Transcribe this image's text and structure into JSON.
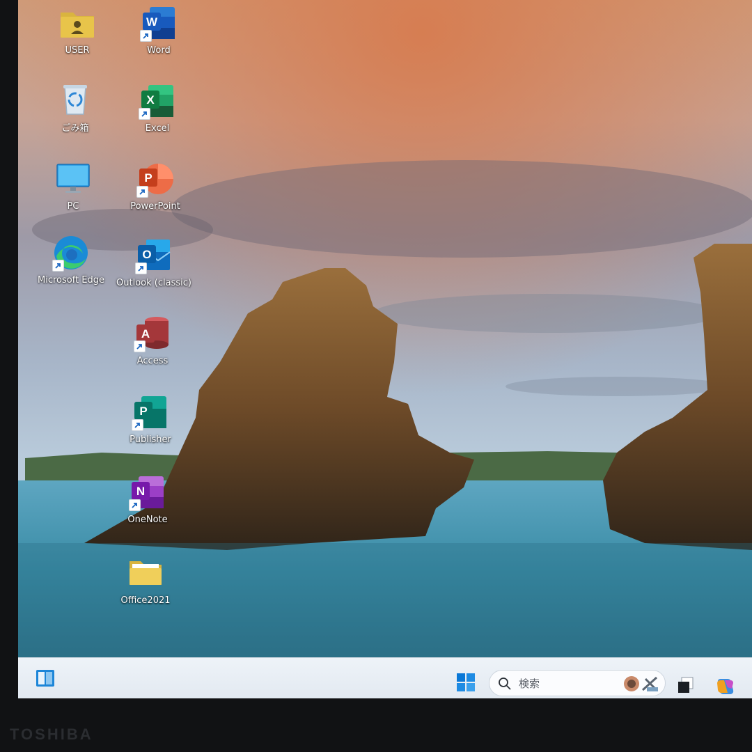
{
  "device": {
    "brand": "TOSHIBA"
  },
  "desktop": {
    "icons": [
      {
        "label": "USER",
        "icon": "user-folder-icon"
      },
      {
        "label": "Word",
        "icon": "word-icon"
      },
      {
        "label": "ごみ箱",
        "icon": "recycle-bin-icon"
      },
      {
        "label": "Excel",
        "icon": "excel-icon"
      },
      {
        "label": "PC",
        "icon": "pc-monitor-icon"
      },
      {
        "label": "PowerPoint",
        "icon": "powerpoint-icon"
      },
      {
        "label": "Microsoft Edge",
        "icon": "edge-icon"
      },
      {
        "label": "Outlook (classic)",
        "icon": "outlook-icon"
      },
      {
        "label": "Access",
        "icon": "access-icon"
      },
      {
        "label": "Publisher",
        "icon": "publisher-icon"
      },
      {
        "label": "OneNote",
        "icon": "onenote-icon"
      },
      {
        "label": "Office2021",
        "icon": "folder-icon"
      }
    ]
  },
  "taskbar": {
    "widgets_icon": "widgets-icon",
    "start_icon": "windows-start-icon",
    "search": {
      "placeholder": "検索",
      "icon": "search-icon"
    },
    "task_view_icon": "task-view-icon",
    "copilot_icon": "copilot-icon"
  },
  "colors": {
    "start_blue": "#0a78d7",
    "word_blue": "#185abd",
    "excel_green": "#107c41",
    "powerpoint_orange": "#c43e1c",
    "outlook_blue": "#0f6cbd",
    "access_red": "#a4373a",
    "publisher_teal": "#077568",
    "onenote_purple": "#7719aa",
    "folder_yellow": "#e8c44a"
  }
}
